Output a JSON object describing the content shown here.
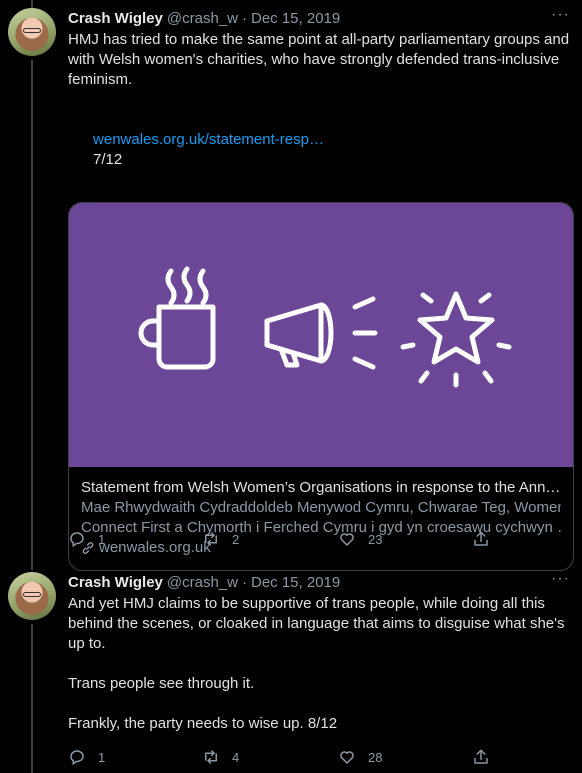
{
  "tweets": [
    {
      "author_name": "Crash Wigley",
      "handle": "@crash_w",
      "date": "Dec 15, 2019",
      "text": "HMJ has tried to make the same point at all-party parliamentary groups and with Welsh women's charities, who have strongly defended trans-inclusive feminism.",
      "link_text": "wenwales.org.uk/statement-resp…",
      "counter": "7/12",
      "card": {
        "title": "Statement from Welsh Women’s Organisations in response to the Ann…",
        "desc_line1": "Mae Rhwydwaith Cydraddoldeb Menywod Cymru, Chwarae Teg, Women",
        "desc_line2": "Connect First a Chymorth i Ferched Cymru i gyd yn croesawu cychwyn …",
        "domain": "wenwales.org.uk",
        "image_bg": "#6c4797"
      },
      "replies": "1",
      "retweets": "2",
      "likes": "23"
    },
    {
      "author_name": "Crash Wigley",
      "handle": "@crash_w",
      "date": "Dec 15, 2019",
      "text": "And yet HMJ claims to be supportive of trans people, while doing all this behind the scenes, or cloaked in language that aims to disguise what she's up to.\n\nTrans people see through it.\n\nFrankly, the party needs to wise up. 8/12",
      "replies": "1",
      "retweets": "4",
      "likes": "28"
    }
  ],
  "more_glyph": "···",
  "separator": "·",
  "colors": {
    "background": "#000000",
    "link": "#1d9bf0",
    "muted": "#8b98a5"
  }
}
